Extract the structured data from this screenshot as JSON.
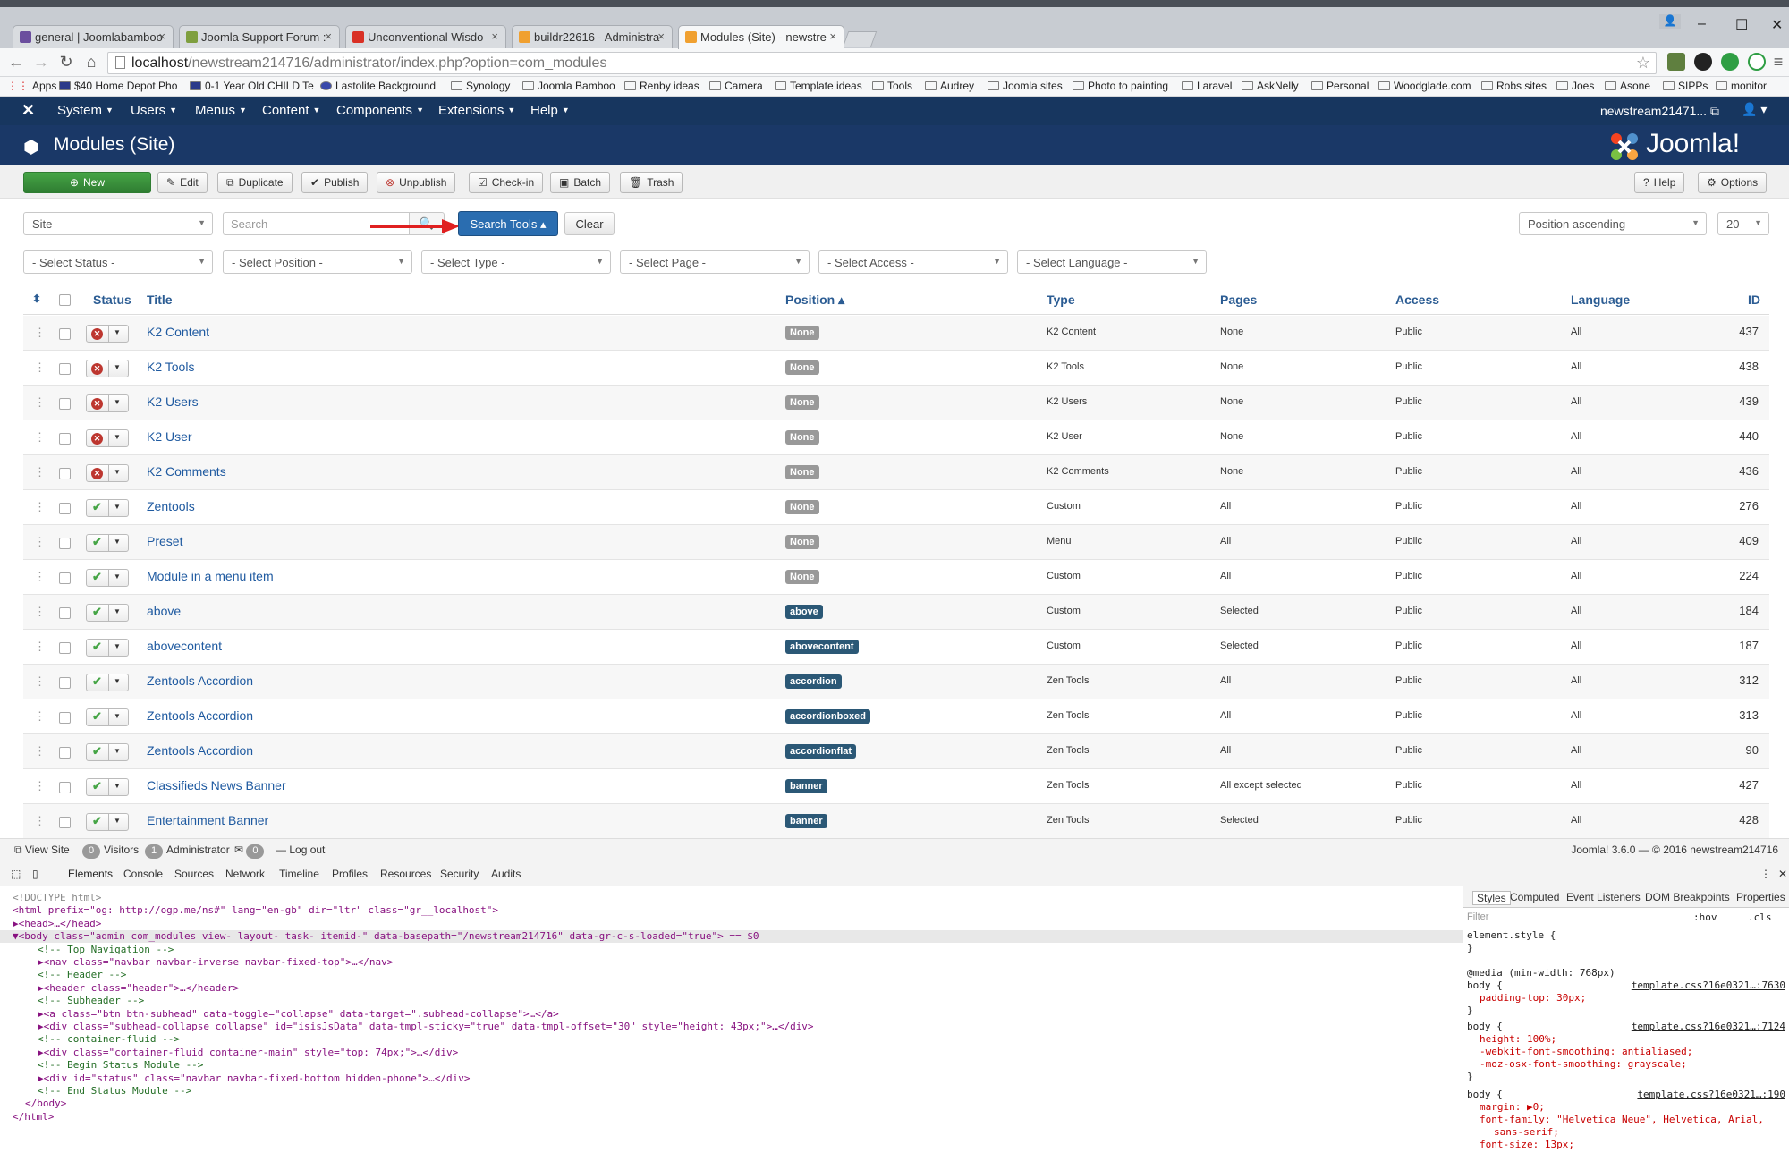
{
  "browser": {
    "tabs": [
      {
        "label": "general | Joomlabamboo",
        "color": "#6b4e9e"
      },
      {
        "label": "Joomla Support Forum :",
        "color": "#7f9f3f"
      },
      {
        "label": "Unconventional Wisdo",
        "color": "#d93025"
      },
      {
        "label": "buildr22616 - Administra",
        "color": "#f0a030"
      },
      {
        "label": "Modules (Site) - newstre",
        "color": "#f0a030"
      }
    ],
    "url_host": "localhost",
    "url_path": "/newstream214716/administrator/index.php?option=com_modules",
    "bookmarks": [
      "Apps",
      "$40 Home Depot Pho",
      "0-1 Year Old CHILD Te",
      "Lastolite Background",
      "Synology",
      "Joomla Bamboo",
      "Renby ideas",
      "Camera",
      "Template ideas",
      "Tools",
      "Audrey",
      "Joomla sites",
      "Photo to painting",
      "Laravel",
      "AskNelly",
      "Personal",
      "Woodglade.com",
      "Robs sites",
      "Joes",
      "Asone",
      "SIPPs",
      "monitor"
    ]
  },
  "navbar": {
    "menus": [
      "System",
      "Users",
      "Menus",
      "Content",
      "Components",
      "Extensions",
      "Help"
    ],
    "user": "newstream21471... ⧉"
  },
  "header": {
    "title": "Modules (Site)",
    "logo_text": "Joomla!"
  },
  "toolbar": {
    "new": "New",
    "edit": "Edit",
    "duplicate": "Duplicate",
    "publish": "Publish",
    "unpublish": "Unpublish",
    "checkin": "Check-in",
    "batch": "Batch",
    "trash": "Trash",
    "help": "Help",
    "options": "Options"
  },
  "filters": {
    "client": "Site",
    "search_placeholder": "Search",
    "search_tools": "Search Tools ▴",
    "clear": "Clear",
    "ordering": "Position ascending",
    "limit": "20",
    "status": "- Select Status -",
    "position": "- Select Position -",
    "type": "- Select Type -",
    "page": "- Select Page -",
    "access": "- Select Access -",
    "language": "- Select Language -"
  },
  "table": {
    "headers": {
      "status": "Status",
      "title": "Title",
      "position": "Position ▴",
      "type": "Type",
      "pages": "Pages",
      "access": "Access",
      "language": "Language",
      "id": "ID"
    },
    "rows": [
      {
        "title": "K2 Content",
        "published": false,
        "position": "None",
        "type": "K2 Content",
        "pages": "None",
        "access": "Public",
        "language": "All",
        "id": "437"
      },
      {
        "title": "K2 Tools",
        "published": false,
        "position": "None",
        "type": "K2 Tools",
        "pages": "None",
        "access": "Public",
        "language": "All",
        "id": "438"
      },
      {
        "title": "K2 Users",
        "published": false,
        "position": "None",
        "type": "K2 Users",
        "pages": "None",
        "access": "Public",
        "language": "All",
        "id": "439"
      },
      {
        "title": "K2 User",
        "published": false,
        "position": "None",
        "type": "K2 User",
        "pages": "None",
        "access": "Public",
        "language": "All",
        "id": "440"
      },
      {
        "title": "K2 Comments",
        "published": false,
        "position": "None",
        "type": "K2 Comments",
        "pages": "None",
        "access": "Public",
        "language": "All",
        "id": "436"
      },
      {
        "title": "Zentools",
        "published": true,
        "position": "None",
        "type": "Custom",
        "pages": "All",
        "access": "Public",
        "language": "All",
        "id": "276"
      },
      {
        "title": "Preset",
        "published": true,
        "position": "None",
        "type": "Menu",
        "pages": "All",
        "access": "Public",
        "language": "All",
        "id": "409"
      },
      {
        "title": "Module in a menu item",
        "published": true,
        "position": "None",
        "type": "Custom",
        "pages": "All",
        "access": "Public",
        "language": "All",
        "id": "224"
      },
      {
        "title": "above",
        "published": true,
        "position": "above",
        "type": "Custom",
        "pages": "Selected",
        "access": "Public",
        "language": "All",
        "id": "184"
      },
      {
        "title": "abovecontent",
        "published": true,
        "position": "abovecontent",
        "type": "Custom",
        "pages": "Selected",
        "access": "Public",
        "language": "All",
        "id": "187"
      },
      {
        "title": "Zentools Accordion",
        "published": true,
        "position": "accordion",
        "type": "Zen Tools",
        "pages": "All",
        "access": "Public",
        "language": "All",
        "id": "312"
      },
      {
        "title": "Zentools Accordion",
        "published": true,
        "position": "accordionboxed",
        "type": "Zen Tools",
        "pages": "All",
        "access": "Public",
        "language": "All",
        "id": "313"
      },
      {
        "title": "Zentools Accordion",
        "published": true,
        "position": "accordionflat",
        "type": "Zen Tools",
        "pages": "All",
        "access": "Public",
        "language": "All",
        "id": "90"
      },
      {
        "title": "Classifieds News Banner",
        "published": true,
        "position": "banner",
        "type": "Zen Tools",
        "pages": "All except selected",
        "access": "Public",
        "language": "All",
        "id": "427"
      },
      {
        "title": "Entertainment Banner",
        "published": true,
        "position": "banner",
        "type": "Zen Tools",
        "pages": "Selected",
        "access": "Public",
        "language": "All",
        "id": "428"
      }
    ]
  },
  "statusbar": {
    "view_site": "View Site",
    "visitors_count": "0",
    "visitors": "Visitors",
    "admin_count": "1",
    "admin": "Administrator",
    "messages_count": "0",
    "logout": "Log out",
    "copyright": "Joomla! 3.6.0 — © 2016 newstream214716"
  },
  "devtools": {
    "tabs": [
      "Elements",
      "Console",
      "Sources",
      "Network",
      "Timeline",
      "Profiles",
      "Resources",
      "Security",
      "Audits"
    ],
    "style_tabs": [
      "Styles",
      "Computed",
      "Event Listeners",
      "DOM Breakpoints",
      "Properties"
    ],
    "filter_placeholder": "Filter",
    "hov": ":hov",
    "cls": ".cls",
    "element_lines": [
      "<!DOCTYPE html>",
      "<html prefix=\"og: http://ogp.me/ns#\" lang=\"en-gb\" dir=\"ltr\" class=\"gr__localhost\">",
      "▶<head>…</head>",
      "▼<body class=\"admin com_modules view- layout- task- itemid-\" data-basepath=\"/newstream214716\" data-gr-c-s-loaded=\"true\"> == $0",
      "<!-- Top Navigation -->",
      "▶<nav class=\"navbar navbar-inverse navbar-fixed-top\">…</nav>",
      "<!-- Header -->",
      "▶<header class=\"header\">…</header>",
      "<!-- Subheader -->",
      "▶<a class=\"btn btn-subhead\" data-toggle=\"collapse\" data-target=\".subhead-collapse\">…</a>",
      "▶<div class=\"subhead-collapse collapse\" id=\"isisJsData\" data-tmpl-sticky=\"true\" data-tmpl-offset=\"30\" style=\"height: 43px;\">…</div>",
      "<!-- container-fluid -->",
      "▶<div class=\"container-fluid container-main\" style=\"top: 74px;\">…</div>",
      "<!-- Begin Status Module -->",
      "▶<div id=\"status\" class=\"navbar navbar-fixed-bottom hidden-phone\">…</div>",
      "<!-- End Status Module -->",
      "</body>",
      "</html>"
    ],
    "style_lines": [
      "element.style {",
      "}",
      "@media (min-width: 768px)",
      "body {",
      "padding-top: 30px;",
      "}",
      "body {",
      "height: 100%;",
      "-webkit-font-smoothing: antialiased;",
      "-moz-osx-font-smoothing: grayscale;",
      "}",
      "body {",
      "margin: ▶0;",
      "font-family: \"Helvetica Neue\", Helvetica, Arial,",
      "sans-serif;",
      "font-size: 13px;"
    ],
    "style_sources": [
      "template.css?16e0321…:7630",
      "template.css?16e0321…:7124",
      "template.css?16e0321…:190"
    ]
  }
}
